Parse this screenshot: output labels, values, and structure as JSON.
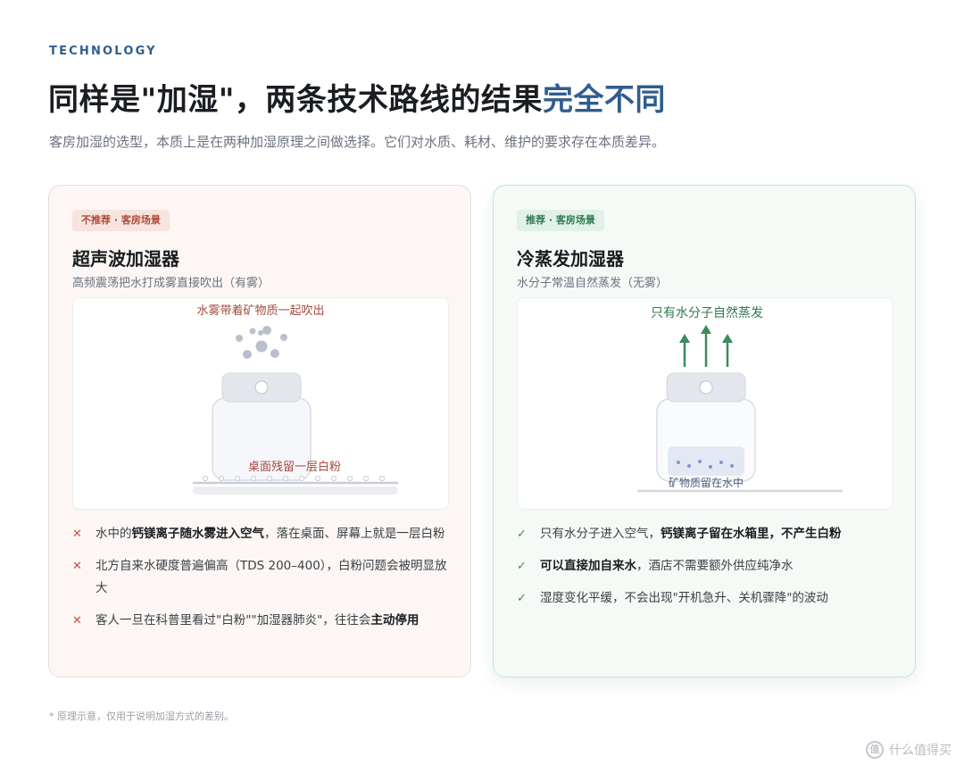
{
  "header": {
    "eyebrow": "TECHNOLOGY",
    "title_main": "同样是\"加湿\"，两条技术路线的结果",
    "title_accent": "完全不同",
    "subtitle": "客房加湿的选型，本质上是在两种加湿原理之间做选择。它们对水质、耗材、维护的要求存在本质差异。"
  },
  "left_card": {
    "badge": "不推荐 · 客房场景",
    "title": "超声波加湿器",
    "desc": "高频震荡把水打成雾直接吹出（有雾）",
    "illus_top_label": "水雾带着矿物质一起吹出",
    "illus_bottom_label": "桌面残留一层白粉",
    "items": [
      {
        "mark": "✕",
        "pre": "水中的",
        "bold": "钙镁离子随水雾进入空气",
        "post": "，落在桌面、屏幕上就是一层白粉"
      },
      {
        "mark": "✕",
        "pre": "北方自来水硬度普遍偏高（TDS 200–400），白粉问题会被明显放大",
        "bold": "",
        "post": ""
      },
      {
        "mark": "✕",
        "pre": "客人一旦在科普里看过\"白粉\"\"加湿器肺炎\"，往往会",
        "bold": "主动停用",
        "post": ""
      }
    ]
  },
  "right_card": {
    "badge": "推荐 · 客房场景",
    "title": "冷蒸发加湿器",
    "desc": "水分子常温自然蒸发（无雾）",
    "illus_top_label": "只有水分子自然蒸发",
    "illus_bottom_label": "矿物质留在水中",
    "items": [
      {
        "mark": "✓",
        "pre": "只有水分子进入空气，",
        "bold": "钙镁离子留在水箱里，不产生白粉",
        "post": ""
      },
      {
        "mark": "✓",
        "pre": "",
        "bold": "可以直接加自来水",
        "post": "，酒店不需要额外供应纯净水"
      },
      {
        "mark": "✓",
        "pre": "湿度变化平缓，不会出现\"开机急升、关机骤降\"的波动",
        "bold": "",
        "post": ""
      }
    ]
  },
  "footnote": "* 原理示意，仅用于说明加湿方式的差别。",
  "watermark": {
    "text": "什么值得买",
    "icon": "zhi-logo-icon",
    "icon_glyph": "值"
  },
  "colors": {
    "accent_blue": "#2f5d8f",
    "warn_red": "#b04a3c",
    "ok_green": "#2f7a4f"
  }
}
